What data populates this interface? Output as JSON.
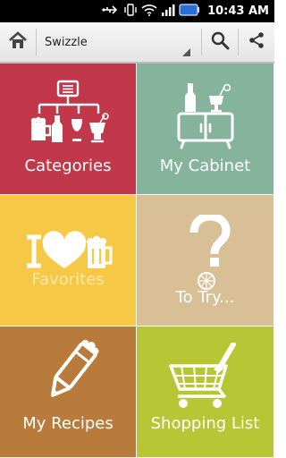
{
  "status_bar": {
    "time": "10:43 AM",
    "icons": [
      "usb-icon",
      "vibrate-icon",
      "wifi-icon",
      "signal-icon",
      "battery-icon"
    ]
  },
  "action_bar": {
    "home_icon": "home-icon",
    "title": "Swizzle",
    "search_icon": "search-icon",
    "share_icon": "share-icon"
  },
  "tiles": [
    {
      "label": "Categories",
      "color": "#c0384a",
      "icon": "categories-icon"
    },
    {
      "label": "My Cabinet",
      "color": "#85b39c",
      "icon": "cabinet-icon"
    },
    {
      "label": "Favorites",
      "color": "#f6c846",
      "label_color": "#fbe9a8",
      "icon": "heart-beer-icon"
    },
    {
      "label": "To Try...",
      "color": "#d8bf96",
      "icon": "question-lime-icon"
    },
    {
      "label": "My Recipes",
      "color": "#b87b3b",
      "icon": "pencil-icon"
    },
    {
      "label": "Shopping List",
      "color": "#b7c634",
      "icon": "cart-icon"
    }
  ]
}
